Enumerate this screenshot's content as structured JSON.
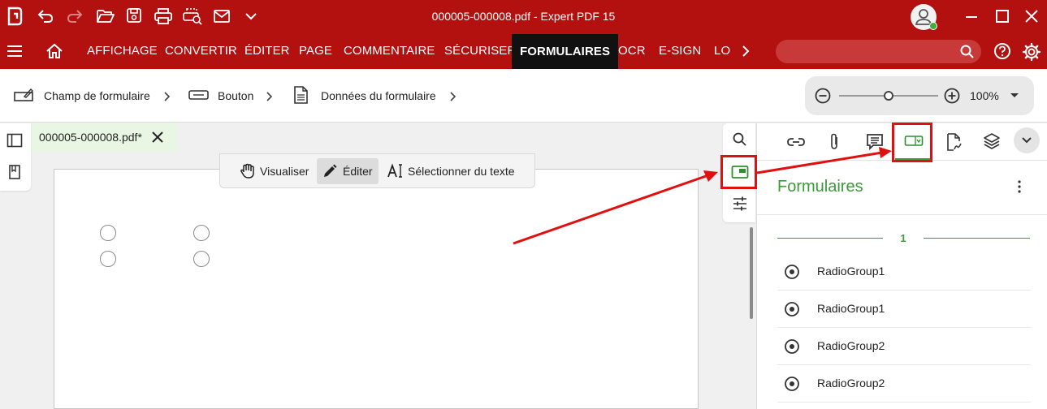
{
  "window": {
    "title": "000005-000008.pdf  -  Expert PDF 15"
  },
  "ribbon": {
    "tabs": [
      {
        "label": "AFFICHAGE"
      },
      {
        "label": "CONVERTIR"
      },
      {
        "label": "ÉDITER"
      },
      {
        "label": "PAGE"
      },
      {
        "label": "COMMENTAIRE"
      },
      {
        "label": "SÉCURISER"
      },
      {
        "label": "FORMULAIRES"
      },
      {
        "label": "OCR"
      },
      {
        "label": "E-SIGN"
      },
      {
        "label": "LO"
      }
    ],
    "active_tab": "FORMULAIRES"
  },
  "form_toolbar": {
    "items": [
      {
        "label": "Champ de formulaire",
        "icon": "form-field-icon"
      },
      {
        "label": "Bouton",
        "icon": "button-field-icon"
      },
      {
        "label": "Données du formulaire",
        "icon": "form-data-icon"
      }
    ],
    "zoom": "100%"
  },
  "document": {
    "tab_label": "000005-000008.pdf*",
    "modes": [
      {
        "label": "Visualiser",
        "icon": "hand-icon"
      },
      {
        "label": "Éditer",
        "icon": "pencil-icon"
      },
      {
        "label": "Sélectionner du texte",
        "icon": "text-select-icon"
      }
    ],
    "active_mode": "Éditer"
  },
  "panel": {
    "title": "Formulaires",
    "page_number": "1",
    "fields": [
      {
        "label": "RadioGroup1"
      },
      {
        "label": "RadioGroup1"
      },
      {
        "label": "RadioGroup2"
      },
      {
        "label": "RadioGroup2"
      }
    ]
  },
  "colors": {
    "brand_red": "#b31010",
    "accent_green": "#3b9a3b",
    "annotation_red": "#e01010"
  }
}
